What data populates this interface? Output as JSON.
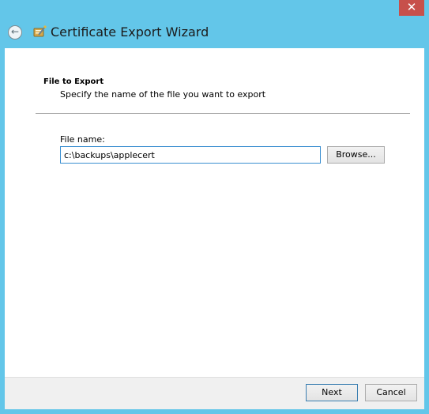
{
  "window": {
    "title": "Certificate Export Wizard",
    "close_glyph": "✕",
    "back_glyph": "←"
  },
  "page": {
    "heading": "File to Export",
    "description": "Specify the name of the file you want to export"
  },
  "file": {
    "label": "File name:",
    "value": "c:\\backups\\applecert",
    "browse_label": "Browse..."
  },
  "footer": {
    "next_label": "Next",
    "cancel_label": "Cancel"
  },
  "colors": {
    "frame": "#63c6e9",
    "close": "#c7504b"
  }
}
